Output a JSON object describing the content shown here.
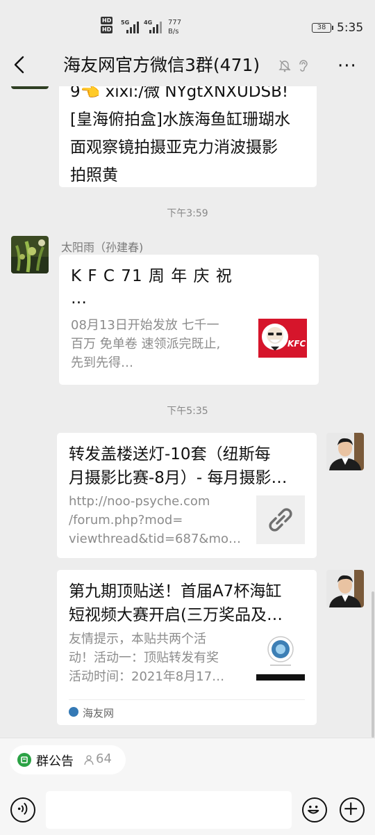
{
  "status_bar": {
    "hd1": "HD",
    "hd2": "HD",
    "net1": "5G",
    "net2": "4G",
    "speed_value": "777",
    "speed_unit": "B/s",
    "battery": "38",
    "time": "5:35"
  },
  "header": {
    "title": "海友网官方微信3群(471)",
    "more_label": "···"
  },
  "messages": {
    "msg1": {
      "line1": "9👈 xixi:/微 NYgtXNXUDSB!",
      "line2": "[皇海俯拍盒]水族海鱼缸珊瑚水",
      "line3": "面观察镜拍摄亚克力消波摄影",
      "line4": "拍照黄"
    },
    "time1": "下午3:59",
    "msg2": {
      "sender": "太阳雨（孙建春)",
      "title_line1": "K F C 71 周 年 庆 祝",
      "title_line2": "…",
      "desc_line1": "08月13日开始发放 七千一",
      "desc_line2": "百万 免单卷 速领派完既止,",
      "desc_line3": "先到先得…",
      "thumb_text": "KFC"
    },
    "time2": "下午5:35",
    "msg3": {
      "title_line1": "转发盖楼送灯-10套（纽斯每",
      "title_line2": "月摄影比赛-8月）- 每月摄影…",
      "desc_line1": "http://noo-psyche.com",
      "desc_line2": "/forum.php?mod=",
      "desc_line3": "viewthread&tid=687&mo…"
    },
    "msg4": {
      "title_line1": "第九期顶贴送！首届A7杯海缸",
      "title_line2": "短视频大赛开启(三万奖品及…",
      "desc_line1": "友情提示，本贴共两个活",
      "desc_line2": "动！活动一：顶贴转发有奖",
      "desc_line3": "活动时间：2021年8月17…",
      "source": "海友网"
    }
  },
  "bottom": {
    "notice_label": "群公告",
    "notice_count": "64"
  },
  "colors": {
    "accent_green": "#2ba245",
    "kfc_red": "#d6152b",
    "background": "#ededed"
  }
}
